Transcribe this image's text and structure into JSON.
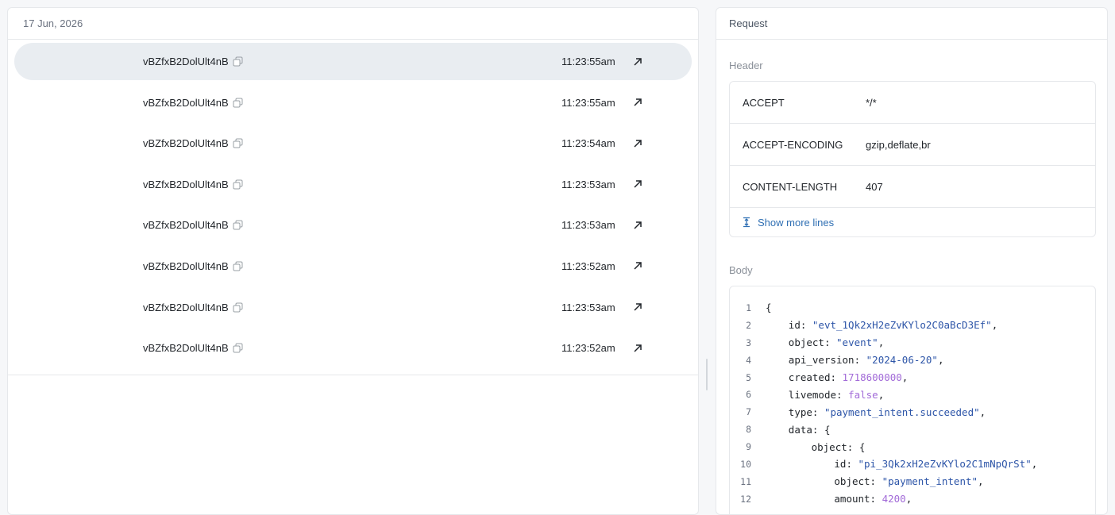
{
  "list": {
    "date_header": "17 Jun, 2026",
    "rows": [
      {
        "id": "vBZfxB2DolUlt4nB",
        "time": "11:23:55am",
        "selected": true
      },
      {
        "id": "vBZfxB2DolUlt4nB",
        "time": "11:23:55am"
      },
      {
        "id": "vBZfxB2DolUlt4nB",
        "time": "11:23:54am"
      },
      {
        "id": "vBZfxB2DolUlt4nB",
        "time": "11:23:53am"
      },
      {
        "id": "vBZfxB2DolUlt4nB",
        "time": "11:23:53am"
      },
      {
        "id": "vBZfxB2DolUlt4nB",
        "time": "11:23:52am"
      },
      {
        "id": "vBZfxB2DolUlt4nB",
        "time": "11:23:53am"
      },
      {
        "id": "vBZfxB2DolUlt4nB",
        "time": "11:23:52am"
      }
    ]
  },
  "request": {
    "title": "Request",
    "header_label": "Header",
    "headers": [
      {
        "key": "ACCEPT",
        "value": "*/*"
      },
      {
        "key": "ACCEPT-ENCODING",
        "value": "gzip,deflate,br"
      },
      {
        "key": "CONTENT-LENGTH",
        "value": "407"
      }
    ],
    "show_more_label": "Show more lines",
    "body_label": "Body",
    "body_lines": [
      {
        "n": "1",
        "indent": 0,
        "tokens": [
          [
            "punc",
            "{"
          ]
        ]
      },
      {
        "n": "2",
        "indent": 1,
        "tokens": [
          [
            "key",
            "id: "
          ],
          [
            "str",
            "\"evt_1Qk2xH2eZvKYlo2C0aBcD3Ef\""
          ],
          [
            "punc",
            ","
          ]
        ]
      },
      {
        "n": "3",
        "indent": 1,
        "tokens": [
          [
            "key",
            "object: "
          ],
          [
            "str",
            "\"event\""
          ],
          [
            "punc",
            ","
          ]
        ]
      },
      {
        "n": "4",
        "indent": 1,
        "tokens": [
          [
            "key",
            "api_version: "
          ],
          [
            "str",
            "\"2024-06-20\""
          ],
          [
            "punc",
            ","
          ]
        ]
      },
      {
        "n": "5",
        "indent": 1,
        "tokens": [
          [
            "key",
            "created: "
          ],
          [
            "num",
            "1718600000"
          ],
          [
            "punc",
            ","
          ]
        ]
      },
      {
        "n": "6",
        "indent": 1,
        "tokens": [
          [
            "key",
            "livemode: "
          ],
          [
            "num",
            "false"
          ],
          [
            "punc",
            ","
          ]
        ]
      },
      {
        "n": "7",
        "indent": 1,
        "tokens": [
          [
            "key",
            "type: "
          ],
          [
            "str",
            "\"payment_intent.succeeded\""
          ],
          [
            "punc",
            ","
          ]
        ]
      },
      {
        "n": "8",
        "indent": 1,
        "tokens": [
          [
            "key",
            "data: "
          ],
          [
            "punc",
            "{"
          ]
        ]
      },
      {
        "n": "9",
        "indent": 2,
        "tokens": [
          [
            "key",
            "object: "
          ],
          [
            "punc",
            "{"
          ]
        ]
      },
      {
        "n": "10",
        "indent": 3,
        "tokens": [
          [
            "key",
            "id: "
          ],
          [
            "str",
            "\"pi_3Qk2xH2eZvKYlo2C1mNpQrSt\""
          ],
          [
            "punc",
            ","
          ]
        ]
      },
      {
        "n": "11",
        "indent": 3,
        "tokens": [
          [
            "key",
            "object: "
          ],
          [
            "str",
            "\"payment_intent\""
          ],
          [
            "punc",
            ","
          ]
        ]
      },
      {
        "n": "12",
        "indent": 3,
        "tokens": [
          [
            "key",
            "amount: "
          ],
          [
            "num",
            "4200"
          ],
          [
            "punc",
            ","
          ]
        ]
      }
    ]
  },
  "icons": {
    "copy": "copy-icon",
    "open": "arrow-up-right-icon",
    "expand": "expand-vertical-icon"
  },
  "colors": {
    "selected_row": "#e9edf1",
    "link": "#2f6fb3",
    "string": "#2d55a8",
    "number": "#a26bd8"
  }
}
